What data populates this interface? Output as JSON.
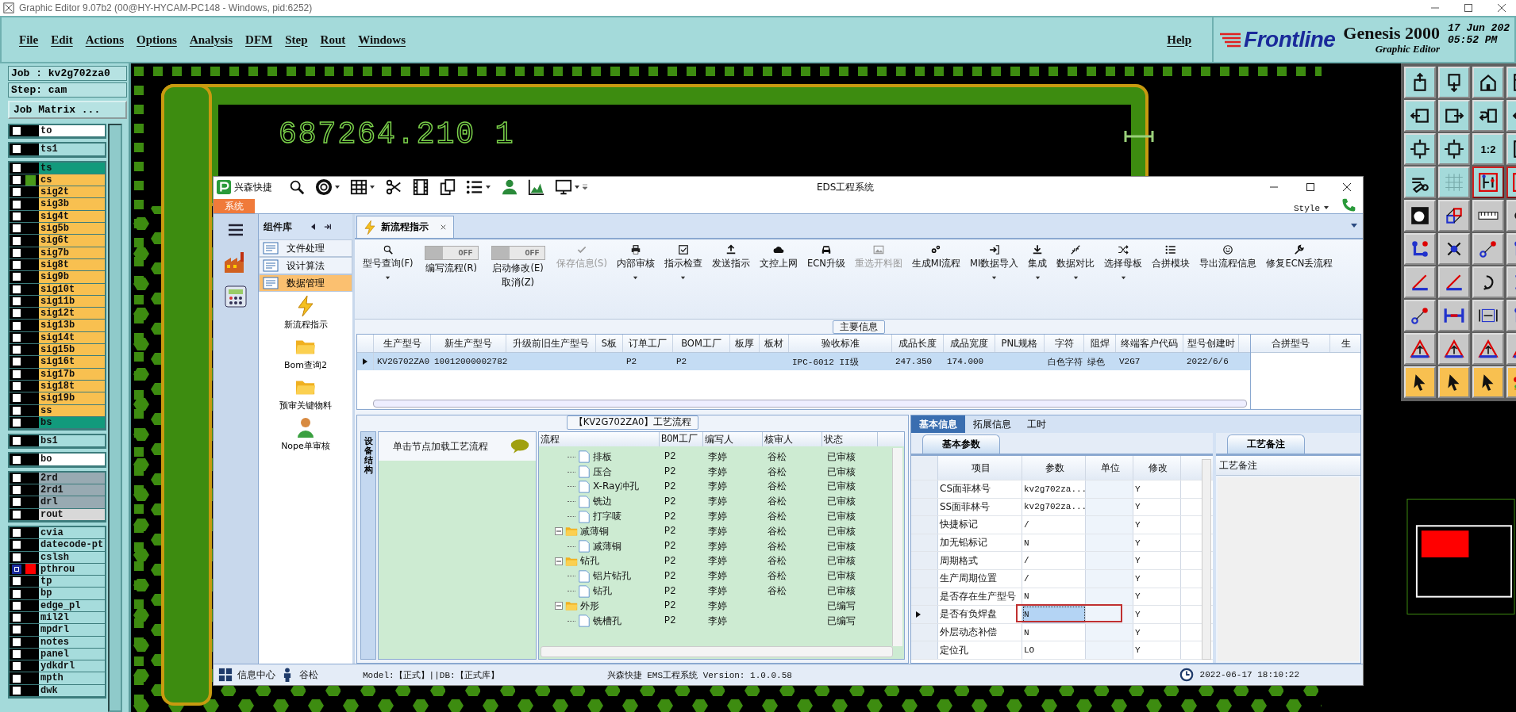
{
  "window": {
    "title": "Graphic Editor 9.07b2 (00@HY-HYCAM-PC148 - Windows, pid:6252)"
  },
  "menu": [
    "File",
    "Edit",
    "Actions",
    "Options",
    "Analysis",
    "DFM",
    "Step",
    "Rout",
    "Windows"
  ],
  "help": "Help",
  "brand": {
    "logo": "Frontline",
    "product": "Genesis 2000",
    "subtitle": "Graphic Editor",
    "date": "17 Jun 202",
    "time": "05:52 PM"
  },
  "job": {
    "job": "Job : kv2g702za0",
    "step": "Step: cam",
    "matrix_button": "Job Matrix ..."
  },
  "layer_groups": [
    {
      "layers": [
        {
          "name": "to",
          "kind": "silk",
          "selected": false
        }
      ]
    },
    {
      "layers": [
        {
          "name": "ts1",
          "kind": "misc",
          "selected": false
        }
      ]
    },
    {
      "layers": [
        {
          "name": "ts",
          "kind": "mask",
          "selected": false
        },
        {
          "name": "cs",
          "kind": "signal",
          "color": "#4a9a1a",
          "selected": false
        },
        {
          "name": "sig2t",
          "kind": "signal",
          "selected": false
        },
        {
          "name": "sig3b",
          "kind": "signal",
          "selected": false
        },
        {
          "name": "sig4t",
          "kind": "signal",
          "selected": false
        },
        {
          "name": "sig5b",
          "kind": "signal",
          "selected": false
        },
        {
          "name": "sig6t",
          "kind": "signal",
          "selected": false
        },
        {
          "name": "sig7b",
          "kind": "signal",
          "selected": false
        },
        {
          "name": "sig8t",
          "kind": "signal",
          "selected": false
        },
        {
          "name": "sig9b",
          "kind": "signal",
          "selected": false
        },
        {
          "name": "sig10t",
          "kind": "signal",
          "selected": false
        },
        {
          "name": "sig11b",
          "kind": "signal",
          "selected": false
        },
        {
          "name": "sig12t",
          "kind": "signal",
          "selected": false
        },
        {
          "name": "sig13b",
          "kind": "signal",
          "selected": false
        },
        {
          "name": "sig14t",
          "kind": "signal",
          "selected": false
        },
        {
          "name": "sig15b",
          "kind": "signal",
          "selected": false
        },
        {
          "name": "sig16t",
          "kind": "signal",
          "selected": false
        },
        {
          "name": "sig17b",
          "kind": "signal",
          "selected": false
        },
        {
          "name": "sig18t",
          "kind": "signal",
          "selected": false
        },
        {
          "name": "sig19b",
          "kind": "signal",
          "selected": false
        },
        {
          "name": "ss",
          "kind": "signal",
          "selected": false
        },
        {
          "name": "bs",
          "kind": "mask",
          "selected": false
        }
      ]
    },
    {
      "layers": [
        {
          "name": "bs1",
          "kind": "misc",
          "selected": false
        }
      ]
    },
    {
      "layers": [
        {
          "name": "bo",
          "kind": "silk",
          "selected": false
        }
      ]
    },
    {
      "layers": [
        {
          "name": "2rd",
          "kind": "drill",
          "selected": false
        },
        {
          "name": "2rd1",
          "kind": "drill",
          "selected": false
        },
        {
          "name": "drl",
          "kind": "drill",
          "selected": false
        },
        {
          "name": "rout",
          "kind": "rout",
          "selected": false
        }
      ]
    },
    {
      "layers": [
        {
          "name": "cvia",
          "kind": "misc",
          "selected": false
        },
        {
          "name": "datecode-pt",
          "kind": "misc",
          "selected": false
        },
        {
          "name": "cslsh",
          "kind": "misc",
          "selected": false
        },
        {
          "name": "pthrou",
          "kind": "misc",
          "color": "#ff0000",
          "selected": true
        },
        {
          "name": "tp",
          "kind": "misc",
          "selected": false
        },
        {
          "name": "bp",
          "kind": "misc",
          "selected": false
        },
        {
          "name": "edge_pl",
          "kind": "misc",
          "selected": false
        },
        {
          "name": "mil2l",
          "kind": "misc",
          "selected": false
        },
        {
          "name": "mpdrl",
          "kind": "misc",
          "selected": false
        },
        {
          "name": "notes",
          "kind": "misc",
          "selected": false
        },
        {
          "name": "panel",
          "kind": "misc",
          "selected": false
        },
        {
          "name": "ydkdrl",
          "kind": "misc",
          "selected": false
        },
        {
          "name": "mpth",
          "kind": "misc",
          "selected": false
        },
        {
          "name": "dwk",
          "kind": "misc",
          "selected": false
        }
      ]
    }
  ],
  "canvas": {
    "label": "687264.210 1"
  },
  "toolbox": {
    "ratio_button": "1:2"
  },
  "eds": {
    "app_name": "兴森快捷",
    "title": "EDS工程系统",
    "system_tab": "系统",
    "style": "Style",
    "component_header": "组件库",
    "categories": [
      {
        "label": "文件处理",
        "selected": false
      },
      {
        "label": "设计算法",
        "selected": false
      },
      {
        "label": "数据管理",
        "selected": true
      }
    ],
    "modules": [
      {
        "label": "新流程指示",
        "kind": "lightning"
      },
      {
        "label": "Bom查询2",
        "kind": "folder"
      },
      {
        "label": "预审关键物料",
        "kind": "folder"
      },
      {
        "label": "Nope单审核",
        "kind": "person"
      }
    ],
    "document_tab": {
      "label": "新流程指示"
    },
    "ribbon": [
      {
        "kind": "button",
        "label": "型号查询(F)",
        "dropdown": true,
        "disabled": false
      },
      {
        "kind": "toggle",
        "label": "编写流程(R)",
        "state_text": "OFF",
        "on": false
      },
      {
        "kind": "toggle",
        "label": "启动修改(E)",
        "label2": "取消(Z)",
        "state_text": "OFF",
        "on": false
      },
      {
        "kind": "button",
        "label": "保存信息(S)",
        "dropdown": false,
        "disabled": true
      },
      {
        "kind": "button",
        "label": "内部审核",
        "dropdown": true,
        "disabled": false
      },
      {
        "kind": "button",
        "label": "指示检查",
        "dropdown": true,
        "disabled": false
      },
      {
        "kind": "button",
        "label": "发送指示",
        "dropdown": false,
        "disabled": false
      },
      {
        "kind": "button",
        "label": "文控上网",
        "dropdown": false,
        "disabled": false
      },
      {
        "kind": "button",
        "label": "ECN升级",
        "dropdown": false,
        "disabled": false
      },
      {
        "kind": "button",
        "label": "重选开料图",
        "dropdown": false,
        "disabled": true
      },
      {
        "kind": "button",
        "label": "生成MI流程",
        "dropdown": false,
        "disabled": false
      },
      {
        "kind": "button",
        "label": "MI数据导入",
        "dropdown": true,
        "disabled": false
      },
      {
        "kind": "button",
        "label": "集成",
        "dropdown": true,
        "disabled": false
      },
      {
        "kind": "button",
        "label": "数据对比",
        "dropdown": true,
        "disabled": false
      },
      {
        "kind": "button",
        "label": "选择母板",
        "dropdown": true,
        "disabled": false
      },
      {
        "kind": "button",
        "label": "合拼模块",
        "dropdown": false,
        "disabled": false
      },
      {
        "kind": "button",
        "label": "导出流程信息",
        "dropdown": false,
        "disabled": false
      },
      {
        "kind": "button",
        "label": "修复ECN丢流程",
        "dropdown": false,
        "disabled": false
      }
    ],
    "main_info_label": "主要信息",
    "main_table": {
      "columns": [
        "生产型号",
        "新生产型号",
        "升级前旧生产型号",
        "S板",
        "订单工厂",
        "BOM工厂",
        "板厚",
        "板材",
        "验收标准",
        "成品长度",
        "成品宽度",
        "PNL规格",
        "字符",
        "阻焊",
        "终端客户代码",
        "型号创建时"
      ],
      "rows": [
        {
          "selected": true,
          "cells": [
            "KV2G702ZA0",
            "10012000002782",
            "",
            "",
            "P2",
            "P2",
            "",
            "",
            "IPC-6012 II级",
            "247.350",
            "174.000",
            "",
            "白色字符",
            "绿色",
            "V2G7",
            "2022/6/6"
          ]
        }
      ]
    },
    "side_table": {
      "columns": [
        "合拼型号",
        "生"
      ]
    },
    "flow": {
      "title": "【KV2G702ZA0】工艺流程",
      "side_tab": "设备结构",
      "hint": "单击节点加载工艺流程",
      "columns": [
        "流程",
        "BOM工厂",
        "编写人",
        "核审人",
        "状态"
      ],
      "rows": [
        {
          "children": [
            {
              "name": "排板",
              "factory": "P2",
              "writer": "李婷",
              "reviewer": "谷松",
              "status": "已审核"
            },
            {
              "name": "压合",
              "factory": "P2",
              "writer": "李婷",
              "reviewer": "谷松",
              "status": "已审核"
            },
            {
              "name": "X-Ray冲孔",
              "factory": "P2",
              "writer": "李婷",
              "reviewer": "谷松",
              "status": "已审核"
            },
            {
              "name": "铣边",
              "factory": "P2",
              "writer": "李婷",
              "reviewer": "谷松",
              "status": "已审核"
            },
            {
              "name": "打字唛",
              "factory": "P2",
              "writer": "李婷",
              "reviewer": "谷松",
              "status": "已审核"
            }
          ]
        },
        {
          "name": "减薄铜",
          "factory": "P2",
          "writer": "李婷",
          "reviewer": "谷松",
          "status": "已审核",
          "expanded": true,
          "children": [
            {
              "name": "减薄铜",
              "factory": "P2",
              "writer": "李婷",
              "reviewer": "谷松",
              "status": "已审核"
            }
          ]
        },
        {
          "name": "钻孔",
          "factory": "P2",
          "writer": "李婷",
          "reviewer": "谷松",
          "status": "已审核",
          "expanded": true,
          "children": [
            {
              "name": "铝片钻孔",
              "factory": "P2",
              "writer": "李婷",
              "reviewer": "谷松",
              "status": "已审核"
            },
            {
              "name": "钻孔",
              "factory": "P2",
              "writer": "李婷",
              "reviewer": "谷松",
              "status": "已审核"
            }
          ]
        },
        {
          "name": "外形",
          "factory": "P2",
          "writer": "李婷",
          "status": "已编写",
          "expanded": true,
          "children": [
            {
              "name": "铣槽孔",
              "factory": "P2",
              "writer": "李婷",
              "status": "已编写"
            }
          ]
        }
      ]
    },
    "info_tabs": [
      {
        "label": "基本信息",
        "selected": true
      },
      {
        "label": "拓展信息",
        "selected": false
      },
      {
        "label": "工时",
        "selected": false
      }
    ],
    "params_tab": "基本参数",
    "params": {
      "columns": [
        "项目",
        "参数",
        "单位",
        "修改"
      ],
      "rows": [
        {
          "item": "CS面菲林号",
          "value": "kv2g702za...",
          "modify": "Y",
          "selected": false,
          "highlighted": false
        },
        {
          "item": "SS面菲林号",
          "value": "kv2g702za...",
          "modify": "Y",
          "selected": false,
          "highlighted": false
        },
        {
          "item": "快捷标记",
          "value": "/",
          "modify": "Y",
          "selected": false,
          "highlighted": false
        },
        {
          "item": "加无铅标记",
          "value": "N",
          "modify": "Y",
          "selected": false,
          "highlighted": false
        },
        {
          "item": "周期格式",
          "value": "/",
          "modify": "Y",
          "selected": false,
          "highlighted": false
        },
        {
          "item": "生产周期位置",
          "value": "/",
          "modify": "Y",
          "selected": false,
          "highlighted": false
        },
        {
          "item": "是否存在生产型号",
          "value": "N",
          "modify": "Y",
          "selected": false,
          "highlighted": false
        },
        {
          "item": "是否有负焊盘",
          "value": "N",
          "modify": "Y",
          "selected": true,
          "highlighted": true
        },
        {
          "item": "外层动态补偿",
          "value": "N",
          "modify": "Y",
          "selected": false,
          "highlighted": false
        },
        {
          "item": "定位孔",
          "value": "LO",
          "modify": "Y",
          "selected": false,
          "highlighted": false
        }
      ]
    },
    "notes_tab": "工艺备注",
    "notes_header": "工艺备注",
    "status": {
      "info": "信息中心",
      "user": "谷松",
      "model": "Model:【正式】||DB:【正式库】",
      "version": "兴森快捷 EMS工程系统 Version: 1.0.0.58",
      "datetime": "2022-06-17 18:10:22"
    }
  }
}
